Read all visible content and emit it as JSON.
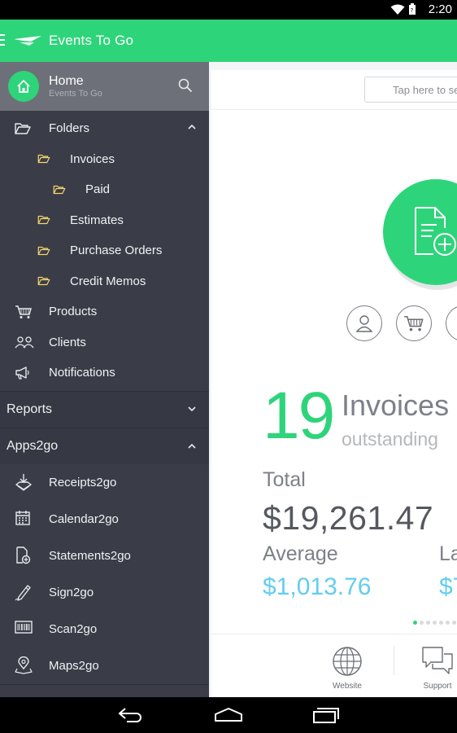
{
  "status": {
    "time": "2:20"
  },
  "app": {
    "title": "Events To Go"
  },
  "drawer": {
    "home": {
      "label": "Home",
      "sublabel": "Events To Go"
    },
    "items": [
      {
        "label": "Folders"
      },
      {
        "label": "Invoices"
      },
      {
        "label": "Paid"
      },
      {
        "label": "Estimates"
      },
      {
        "label": "Purchase Orders"
      },
      {
        "label": "Credit Memos"
      },
      {
        "label": "Products"
      },
      {
        "label": "Clients"
      },
      {
        "label": "Notifications"
      }
    ],
    "sections": {
      "reports": "Reports",
      "apps": "Apps2go"
    },
    "apps": [
      {
        "label": "Receipts2go"
      },
      {
        "label": "Calendar2go"
      },
      {
        "label": "Statements2go"
      },
      {
        "label": "Sign2go"
      },
      {
        "label": "Scan2go"
      },
      {
        "label": "Maps2go"
      }
    ]
  },
  "main": {
    "search_placeholder": "Tap here to se",
    "count": "19",
    "count_label": "Invoices",
    "count_sub": "outstanding",
    "total_label": "Total",
    "total_value": "$19,261.47",
    "average_label": "Average",
    "average_value": "$1,013.76",
    "last_label": "La",
    "last_value": "$7",
    "bottom": {
      "website": "Website",
      "support": "Support"
    }
  },
  "colors": {
    "accent": "#2ed47a",
    "drawer": "#3a3d48",
    "highlight": "#62cdf0"
  }
}
